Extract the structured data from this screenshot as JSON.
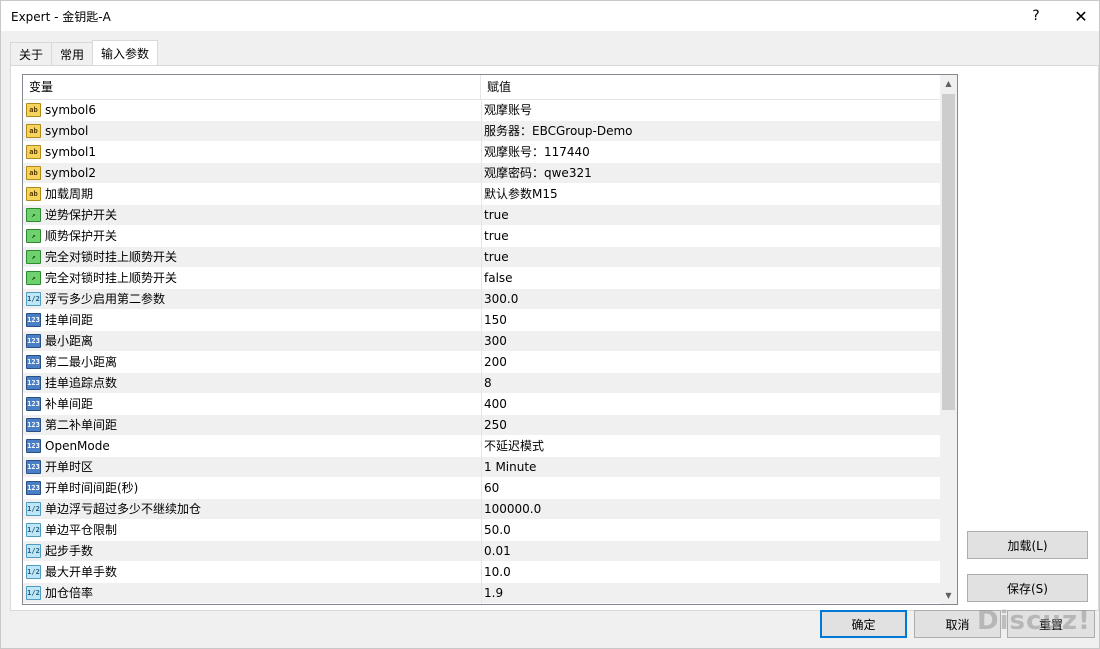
{
  "window": {
    "title": "Expert - 金钥匙-A",
    "help_label": "?",
    "close_label": "✕"
  },
  "tabs": [
    {
      "label": "关于",
      "active": false
    },
    {
      "label": "常用",
      "active": false
    },
    {
      "label": "输入参数",
      "active": true
    }
  ],
  "grid": {
    "columns": {
      "variable": "变量",
      "value": "赋值"
    },
    "rows": [
      {
        "type": "string",
        "icon": "string-type-icon",
        "name": "symbol6",
        "value": "观摩账号"
      },
      {
        "type": "string",
        "icon": "string-type-icon",
        "name": "symbol",
        "value": "服务器：EBCGroup-Demo"
      },
      {
        "type": "string",
        "icon": "string-type-icon",
        "name": "symbol1",
        "value": "观摩账号：117440"
      },
      {
        "type": "string",
        "icon": "string-type-icon",
        "name": "symbol2",
        "value": "观摩密码：qwe321"
      },
      {
        "type": "string",
        "icon": "string-type-icon",
        "name": "加载周期",
        "value": "默认参数M15"
      },
      {
        "type": "bool",
        "icon": "bool-type-icon",
        "name": "逆势保护开关",
        "value": "true"
      },
      {
        "type": "bool",
        "icon": "bool-type-icon",
        "name": "顺势保护开关",
        "value": "true"
      },
      {
        "type": "bool",
        "icon": "bool-type-icon",
        "name": "完全对锁时挂上顺势开关",
        "value": "true"
      },
      {
        "type": "bool",
        "icon": "bool-type-icon",
        "name": "完全对锁时挂上顺势开关",
        "value": "false"
      },
      {
        "type": "double",
        "icon": "double-type-icon",
        "name": "浮亏多少启用第二参数",
        "value": "300.0"
      },
      {
        "type": "int",
        "icon": "int-type-icon",
        "name": "挂单间距",
        "value": "150"
      },
      {
        "type": "int",
        "icon": "int-type-icon",
        "name": "最小距离",
        "value": "300"
      },
      {
        "type": "int",
        "icon": "int-type-icon",
        "name": "第二最小距离",
        "value": "200"
      },
      {
        "type": "int",
        "icon": "int-type-icon",
        "name": "挂单追踪点数",
        "value": "8"
      },
      {
        "type": "int",
        "icon": "int-type-icon",
        "name": "补单间距",
        "value": "400"
      },
      {
        "type": "int",
        "icon": "int-type-icon",
        "name": "第二补单间距",
        "value": "250"
      },
      {
        "type": "int",
        "icon": "int-type-icon",
        "name": "OpenMode",
        "value": "不延迟模式"
      },
      {
        "type": "int",
        "icon": "int-type-icon",
        "name": "开单时区",
        "value": "1 Minute"
      },
      {
        "type": "int",
        "icon": "int-type-icon",
        "name": "开单时间间距(秒)",
        "value": "60"
      },
      {
        "type": "double",
        "icon": "double-type-icon",
        "name": "单边浮亏超过多少不继续加仓",
        "value": "100000.0"
      },
      {
        "type": "double",
        "icon": "double-type-icon",
        "name": "单边平仓限制",
        "value": "50.0"
      },
      {
        "type": "double",
        "icon": "double-type-icon",
        "name": "起步手数",
        "value": "0.01"
      },
      {
        "type": "double",
        "icon": "double-type-icon",
        "name": "最大开单手数",
        "value": "10.0"
      },
      {
        "type": "double",
        "icon": "double-type-icon",
        "name": "加仓倍率",
        "value": "1.9"
      }
    ]
  },
  "icons": {
    "string": "ab",
    "bool": "↗",
    "double": "1/2",
    "int": "123"
  },
  "buttons": {
    "load": "加载(L)",
    "save": "保存(S)",
    "ok": "确定",
    "cancel": "取消",
    "reset": "重置"
  },
  "watermark": "Discuz!",
  "colors": {
    "accent": "#0078d7",
    "row_alt": "#f0f0f0"
  }
}
